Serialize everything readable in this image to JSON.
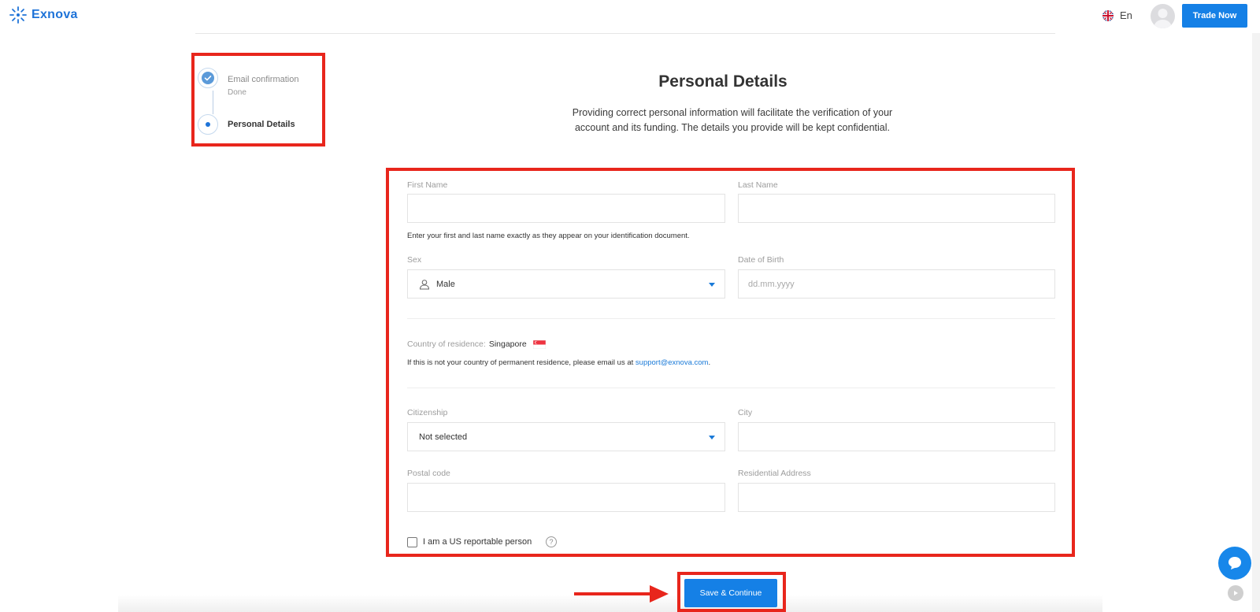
{
  "header": {
    "logo_text": "Exnova",
    "language": "En",
    "trade_button": "Trade Now"
  },
  "steps": [
    {
      "title": "Email confirmation",
      "subtitle": "Done",
      "status": "done"
    },
    {
      "title": "Personal Details",
      "subtitle": "",
      "status": "active"
    }
  ],
  "page": {
    "title": "Personal Details",
    "description": "Providing correct personal information will facilitate the verification of your account and its funding. The details you provide will be kept confidential."
  },
  "form": {
    "first_name_label": "First Name",
    "first_name_value": "",
    "last_name_label": "Last Name",
    "last_name_value": "",
    "name_hint": "Enter your first and last name exactly as they appear on your identification document.",
    "sex_label": "Sex",
    "sex_value": "Male",
    "dob_label": "Date of Birth",
    "dob_placeholder": "dd.mm.yyyy",
    "country_label": "Country of residence:",
    "country_value": "Singapore",
    "country_hint_prefix": "If this is not your country of permanent residence, please email us at",
    "support_email": "support@exnova.com",
    "country_hint_suffix": ".",
    "citizenship_label": "Citizenship",
    "citizenship_value": "Not selected",
    "city_label": "City",
    "city_value": "",
    "postal_label": "Postal code",
    "postal_value": "",
    "address_label": "Residential Address",
    "address_value": "",
    "us_person_label": "I am a US reportable person",
    "help_glyph": "?"
  },
  "save_button": "Save & Continue",
  "colors": {
    "accent": "#1580e6",
    "highlight": "#e8261c"
  },
  "icons": [
    "exnova-logo-icon",
    "uk-flag-icon",
    "avatar-icon",
    "check-icon",
    "user-icon",
    "chevron-down-icon",
    "singapore-flag-icon",
    "help-icon",
    "arrow-right-icon",
    "chat-icon"
  ]
}
